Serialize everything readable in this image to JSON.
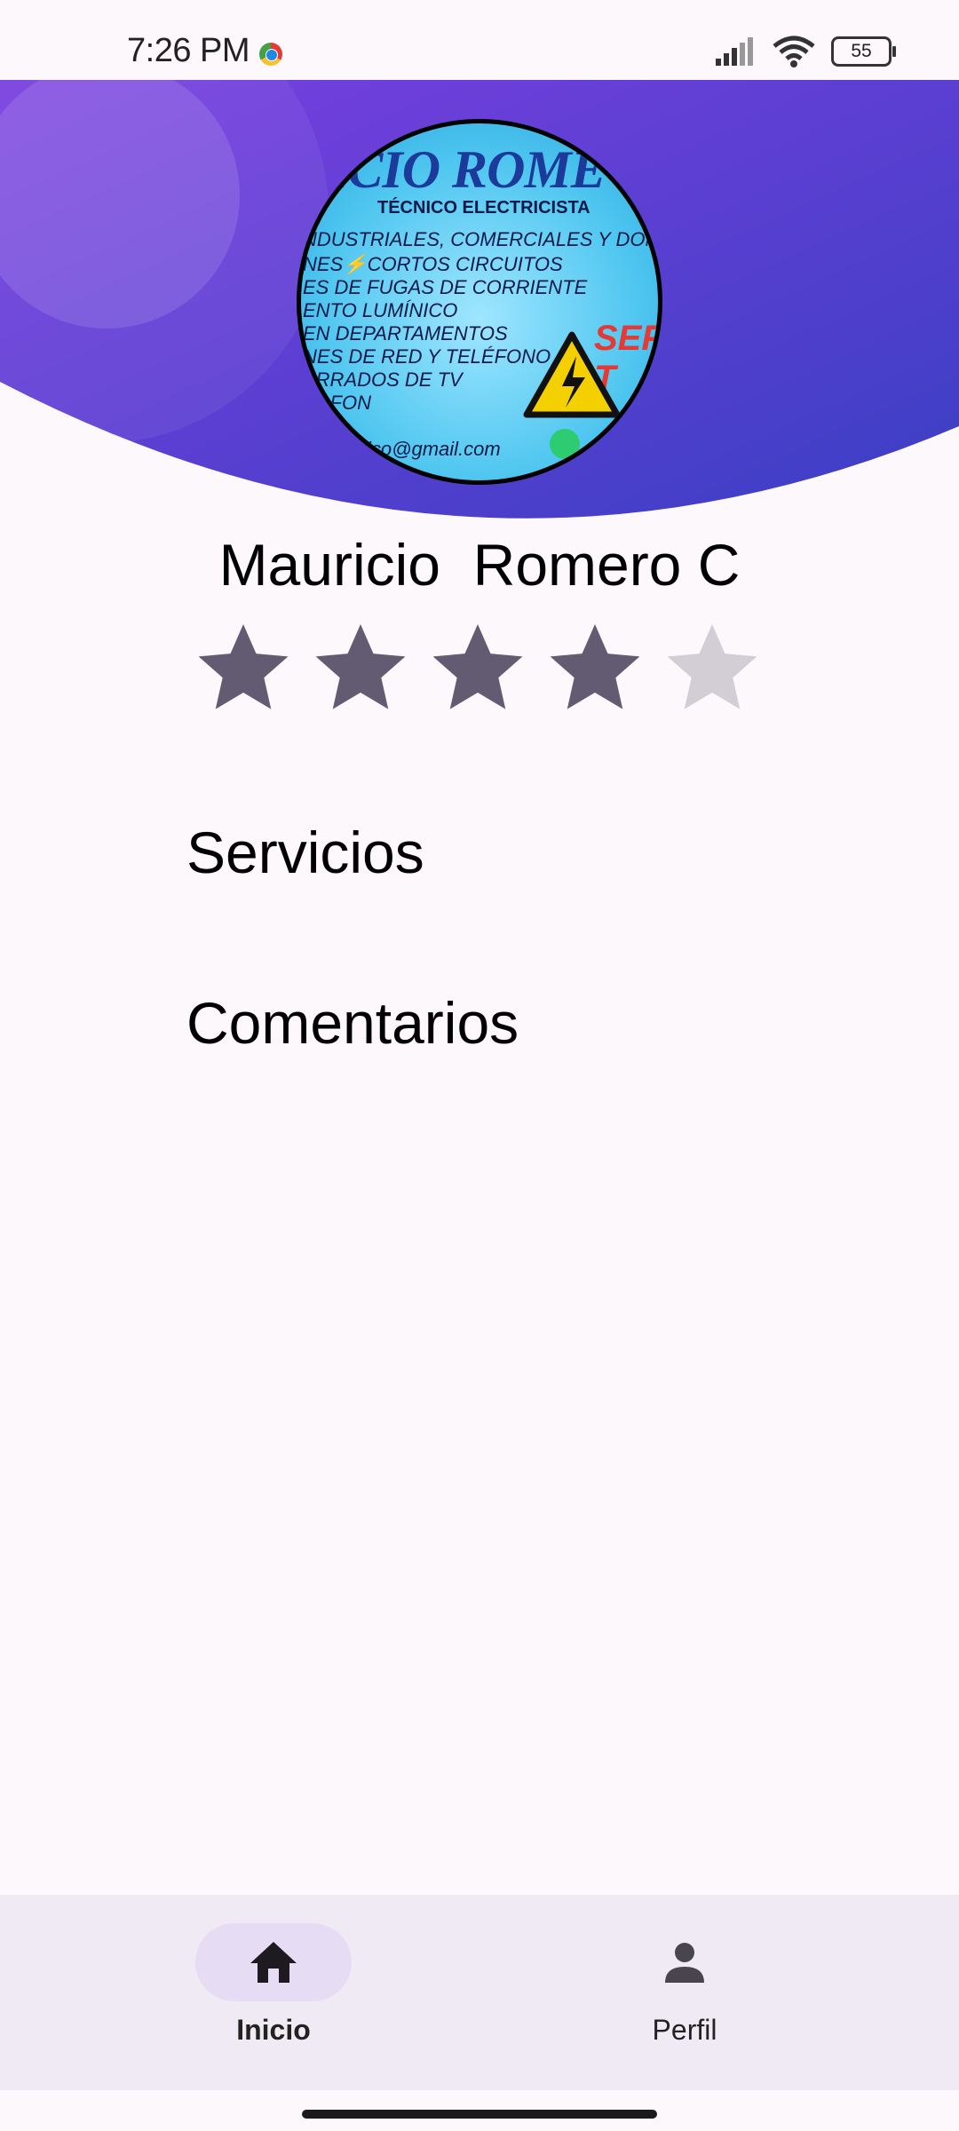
{
  "status_bar": {
    "time": "7:26 PM",
    "battery": "55"
  },
  "profile_card": {
    "title": "ICIO ROME",
    "subtitle": "TÉCNICO ELECTRICISTA",
    "lines": [
      "NDUSTRIALES, COMERCIALES Y DOMICILIARIAS",
      "NES⚡CORTOS CIRCUITOS",
      "ES DE FUGAS DE CORRIENTE",
      "ENTO LUMÍNICO",
      "EN DEPARTAMENTOS",
      "NES DE RED Y TELÉFONO",
      "ERRADOS DE TV",
      "ERFON"
    ],
    "email": "ico@gmail.com",
    "badge": "SEF T"
  },
  "profile": {
    "name": "Mauricio  Romero C",
    "rating": 4,
    "rating_max": 5
  },
  "sections": {
    "services": "Servicios",
    "comments": "Comentarios"
  },
  "bottom_nav": {
    "items": [
      {
        "label": "Inicio",
        "icon": "home-icon",
        "active": true
      },
      {
        "label": "Perfil",
        "icon": "person-icon",
        "active": false
      }
    ]
  },
  "colors": {
    "header_start": "#7a3fe0",
    "header_end": "#3b3fc4",
    "star_filled": "#625b71",
    "star_empty": "#d3ced6",
    "nav_bg": "#f0eaf4",
    "nav_active_pill": "#e6ddf4"
  }
}
